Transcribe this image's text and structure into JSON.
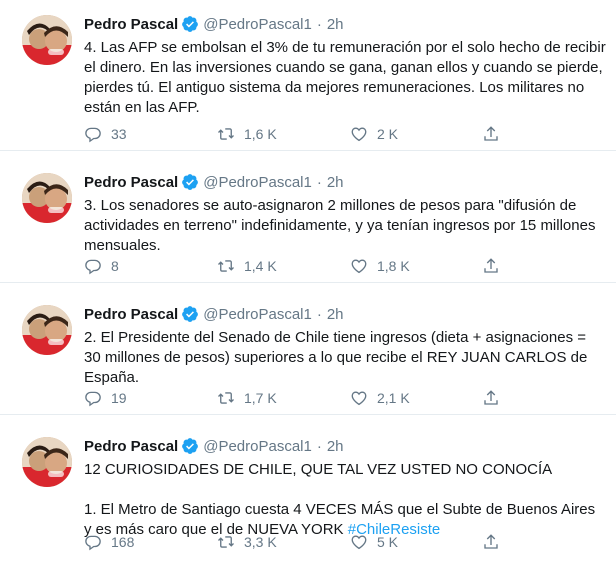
{
  "colors": {
    "text": "#14171a",
    "muted": "#657786",
    "accent": "#1da1f2",
    "divider": "#e6ecf0"
  },
  "tweets": [
    {
      "name": "Pedro Pascal",
      "handle": "@PedroPascal1",
      "dot": "·",
      "time": "2h",
      "text": "4. Las AFP se embolsan el 3% de tu remuneración por el solo hecho de recibir el dinero. En las inversiones cuando se gana, ganan ellos y cuando se pierde, pierdes tú. El antiguo sistema da mejores remuneraciones. Los militares no están en las AFP.",
      "replies": "33",
      "retweets": "1,6 K",
      "likes": "2 K",
      "icons": [
        "reply-icon",
        "retweet-icon",
        "like-icon",
        "share-icon"
      ]
    },
    {
      "name": "Pedro Pascal",
      "handle": "@PedroPascal1",
      "dot": "·",
      "time": "2h",
      "text": "3. Los senadores se auto-asignaron 2 millones de pesos para \"difusión de actividades en terreno\" indefinidamente, y ya tenían ingresos por 15 millones mensuales.",
      "replies": "8",
      "retweets": "1,4 K",
      "likes": "1,8 K"
    },
    {
      "name": "Pedro Pascal",
      "handle": "@PedroPascal1",
      "dot": "·",
      "time": "2h",
      "text": "2. El Presidente del Senado de Chile tiene ingresos (dieta + asignaciones = 30 millones de pesos) superiores a lo que recibe el REY JUAN CARLOS de España.",
      "replies": "19",
      "retweets": "1,7 K",
      "likes": "2,1 K"
    },
    {
      "name": "Pedro Pascal",
      "handle": "@PedroPascal1",
      "dot": "·",
      "time": "2h",
      "text_line1": "12 CURIOSIDADES DE CHILE, QUE TAL VEZ USTED NO CONOCÍA",
      "text_line2": "1. El Metro de Santiago cuesta 4 VECES MÁS que el Subte de Buenos Aires y es más caro que el de NUEVA YORK ",
      "hashtag": "#ChileResiste",
      "replies": "168",
      "retweets": "3,3 K",
      "likes": "5 K"
    }
  ]
}
